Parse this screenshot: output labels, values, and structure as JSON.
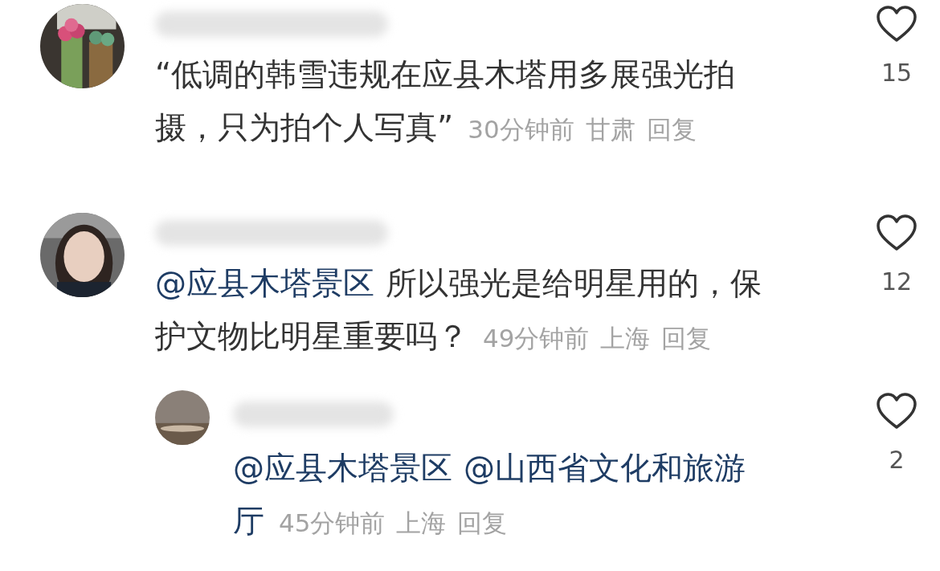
{
  "comments": [
    {
      "avatar": {
        "kind": "picture"
      },
      "lines": [
        [
          {
            "kind": "text",
            "text": "“低调的韩雪违规在应县木塔用多展强光拍"
          }
        ],
        [
          {
            "kind": "text",
            "text": "摄，只为拍个人写真”"
          }
        ]
      ],
      "time": "30分钟前",
      "location": "甘肃",
      "reply_label": "回复",
      "likes": "15",
      "liked": false
    },
    {
      "avatar": {
        "kind": "picture"
      },
      "lines": [
        [
          {
            "kind": "mention",
            "text": "@应县木塔景区"
          },
          {
            "kind": "text",
            "text": "所以强光是给明星用的，保"
          }
        ],
        [
          {
            "kind": "text",
            "text": "护文物比明星重要吗？"
          }
        ]
      ],
      "time": "49分钟前",
      "location": "上海",
      "reply_label": "回复",
      "likes": "12",
      "liked": false,
      "replies": [
        {
          "avatar": {
            "kind": "picture"
          },
          "lines": [
            [
              {
                "kind": "mention",
                "text": "@应县木塔景区"
              },
              {
                "kind": "mention",
                "text": "@山西省文化和旅游"
              }
            ],
            [
              {
                "kind": "mention",
                "text": "厅"
              }
            ]
          ],
          "time": "45分钟前",
          "location": "上海",
          "reply_label": "回复",
          "likes": "2",
          "liked": false
        }
      ]
    }
  ]
}
